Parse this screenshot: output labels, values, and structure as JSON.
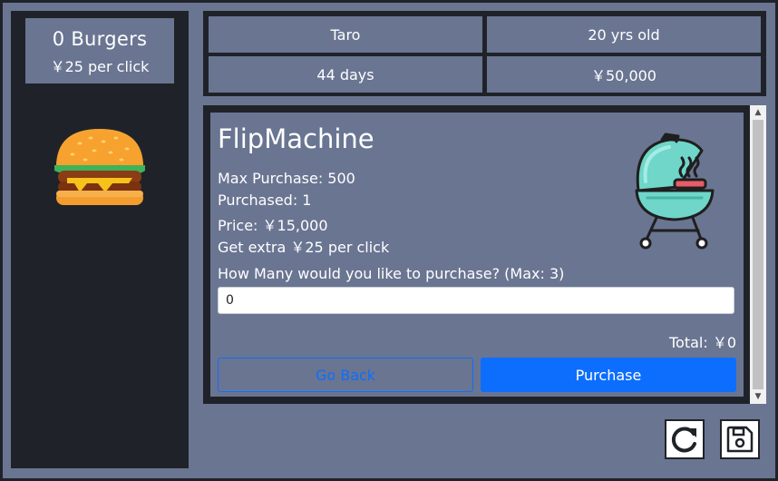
{
  "counter": {
    "burgers_text": "0 Burgers",
    "rate_text": "￥25 per click"
  },
  "player": {
    "name": "Taro",
    "age": "20 yrs old",
    "days": "44 days",
    "money": "￥50,000"
  },
  "item": {
    "name": "FlipMachine",
    "max_purchase": "Max Purchase: 500",
    "purchased": "Purchased: 1",
    "price": "Price: ￥15,000",
    "effect": "Get extra ￥25 per click",
    "prompt": "How Many would you like to purchase? (Max: 3)",
    "quantity_value": "0",
    "total": "Total: ￥0",
    "image_icon": "grill-icon"
  },
  "buttons": {
    "back_label": "Go Back",
    "purchase_label": "Purchase",
    "reset_icon": "refresh-icon",
    "save_icon": "floppy-disk-icon"
  },
  "colors": {
    "background_dark": "#1f2329",
    "panel": "#6a7592",
    "accent": "#0d6efd"
  }
}
